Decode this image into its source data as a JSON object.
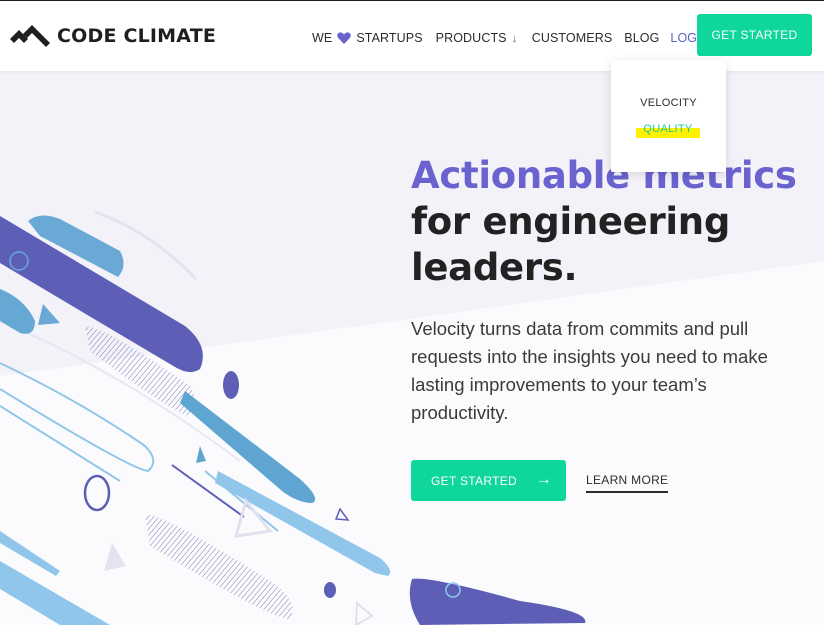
{
  "header": {
    "logo_text": "CODE CLIMATE",
    "nav": {
      "we": "WE",
      "startups": "STARTUPS",
      "products": "PRODUCTS",
      "customers": "CUSTOMERS",
      "blog": "BLOG",
      "login": "LOGIN"
    },
    "cta_label": "GET STARTED",
    "icons": [
      "code-climate-logo-icon",
      "heart-icon",
      "chevron-down-icon"
    ]
  },
  "login_dropdown": {
    "items": [
      "VELOCITY",
      "QUALITY"
    ]
  },
  "hero": {
    "title_accent": "Actionable metrics",
    "title_line2": "for engineering",
    "title_line3": "leaders.",
    "body": "Velocity turns data from commits and pull requests into the insights you need to make lasting improvements to your team’s productivity.",
    "primary_cta": "GET STARTED",
    "secondary_cta": "LEARN MORE"
  },
  "colors": {
    "brand_green": "#0fd69b",
    "accent_purple": "#6a62cf",
    "highlight_yellow": "#fff200",
    "text_dark": "#222222"
  }
}
